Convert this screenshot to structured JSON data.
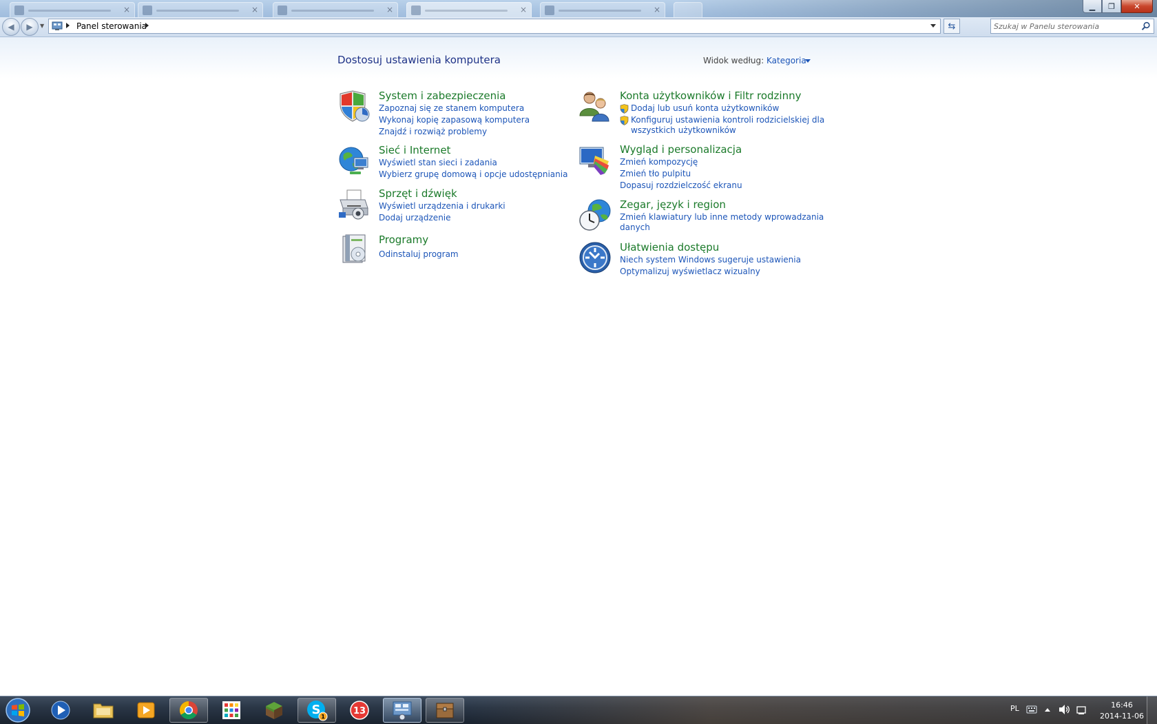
{
  "window": {
    "controls": {
      "minimize_icon": "minimize-icon",
      "maximize_icon": "restore-icon",
      "close_icon": "close-icon"
    }
  },
  "address_bar": {
    "breadcrumb": [
      "Panel sterowania"
    ],
    "search_placeholder": "Szukaj w Panelu sterowania"
  },
  "header": {
    "title": "Dostosuj ustawienia komputera",
    "view_by_label": "Widok według:",
    "view_by_value": "Kategoria"
  },
  "categories_left": [
    {
      "title": "System i zabezpieczenia",
      "icon": "shield-icon",
      "links": [
        "Zapoznaj się ze stanem komputera",
        "Wykonaj kopię zapasową komputera",
        "Znajdź i rozwiąż problemy"
      ]
    },
    {
      "title": "Sieć i Internet",
      "icon": "globe-network-icon",
      "links": [
        "Wyświetl stan sieci i zadania",
        "Wybierz grupę domową i opcje udostępniania"
      ]
    },
    {
      "title": "Sprzęt i dźwięk",
      "icon": "printer-icon",
      "links": [
        "Wyświetl urządzenia i drukarki",
        "Dodaj urządzenie"
      ]
    },
    {
      "title": "Programy",
      "icon": "programs-icon",
      "links": [
        "Odinstaluj program"
      ]
    }
  ],
  "categories_right": [
    {
      "title": "Konta użytkowników i Filtr rodzinny",
      "icon": "users-icon",
      "links": [
        "Dodaj lub usuń konta użytkowników",
        "Konfiguruj ustawienia kontroli rodzicielskiej dla",
        "wszystkich użytkowników"
      ]
    },
    {
      "title": "Wygląd i personalizacja",
      "icon": "appearance-icon",
      "links": [
        "Zmień kompozycję",
        "Zmień tło pulpitu",
        "Dopasuj rozdzielczość ekranu"
      ]
    },
    {
      "title": "Zegar, język i region",
      "icon": "clock-globe-icon",
      "links": [
        "Zmień klawiatury lub inne metody wprowadzania",
        "danych"
      ]
    },
    {
      "title": "Ułatwienia dostępu",
      "icon": "accessibility-icon",
      "links": [
        "Niech system Windows sugeruje ustawienia",
        "Optymalizuj wyświetlacz wizualny"
      ]
    }
  ],
  "taskbar": {
    "items": [
      "start-orb",
      "media-player-icon",
      "file-explorer-icon",
      "media-center-icon",
      "chrome-icon",
      "apps-grid-icon",
      "minecraft-grass-icon",
      "skype-icon",
      "badge-13-icon",
      "control-panel-icon",
      "minecraft-chest-icon"
    ],
    "skype_badge": "1",
    "badge_13_label": "13",
    "tray": {
      "language": "PL",
      "time": "16:46",
      "date": "2014-11-06"
    }
  },
  "colors": {
    "title_blue": "#1e3287",
    "category_green": "#1b7a2a",
    "link_blue": "#1c55b8"
  }
}
